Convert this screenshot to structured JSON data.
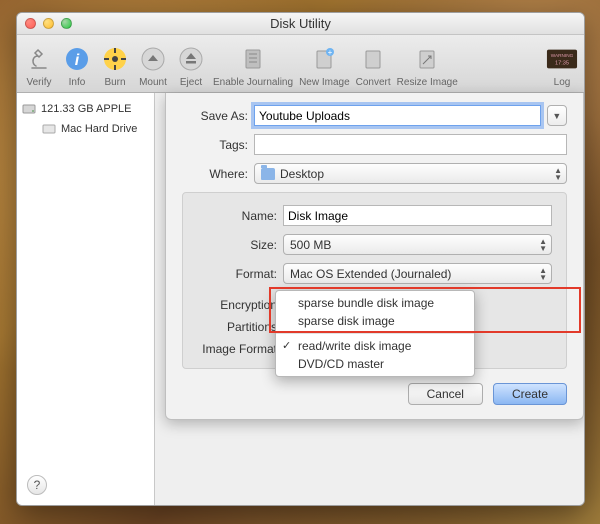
{
  "window": {
    "title": "Disk Utility"
  },
  "toolbar": {
    "items": [
      {
        "label": "Verify",
        "icon": "microscope"
      },
      {
        "label": "Info",
        "icon": "info"
      },
      {
        "label": "Burn",
        "icon": "burn"
      },
      {
        "label": "Mount",
        "icon": "mount"
      },
      {
        "label": "Eject",
        "icon": "eject"
      },
      {
        "label": "Enable Journaling",
        "icon": "journal"
      },
      {
        "label": "New Image",
        "icon": "new-image"
      },
      {
        "label": "Convert",
        "icon": "convert"
      },
      {
        "label": "Resize Image",
        "icon": "resize"
      }
    ],
    "log_label": "Log"
  },
  "sidebar": {
    "disk_label": "121.33 GB APPLE",
    "vol_label": "Mac Hard Drive"
  },
  "sheet": {
    "save_as_label": "Save As:",
    "save_as_value": "Youtube Uploads",
    "tags_label": "Tags:",
    "tags_value": "",
    "where_label": "Where:",
    "where_value": "Desktop",
    "name_label": "Name:",
    "name_value": "Disk Image",
    "size_label": "Size:",
    "size_value": "500 MB",
    "format_label": "Format:",
    "format_value": "Mac OS Extended (Journaled)",
    "encryption_label": "Encryption",
    "partitions_label": "Partitions",
    "image_format_label": "Image Format",
    "cancel_label": "Cancel",
    "create_label": "Create"
  },
  "menu": {
    "items": [
      {
        "label": "sparse bundle disk image",
        "checked": false
      },
      {
        "label": "sparse disk image",
        "checked": false
      },
      {
        "label": "read/write disk image",
        "checked": true
      },
      {
        "label": "DVD/CD master",
        "checked": false
      }
    ]
  },
  "help": {
    "label": "?"
  },
  "icons": {
    "microscope": "🔬",
    "info": "ℹ",
    "burn": "☢",
    "mount": "⏏",
    "eject": "⏏",
    "journal": "📓",
    "new-image": "🗎",
    "convert": "🗎",
    "resize": "🗎"
  }
}
